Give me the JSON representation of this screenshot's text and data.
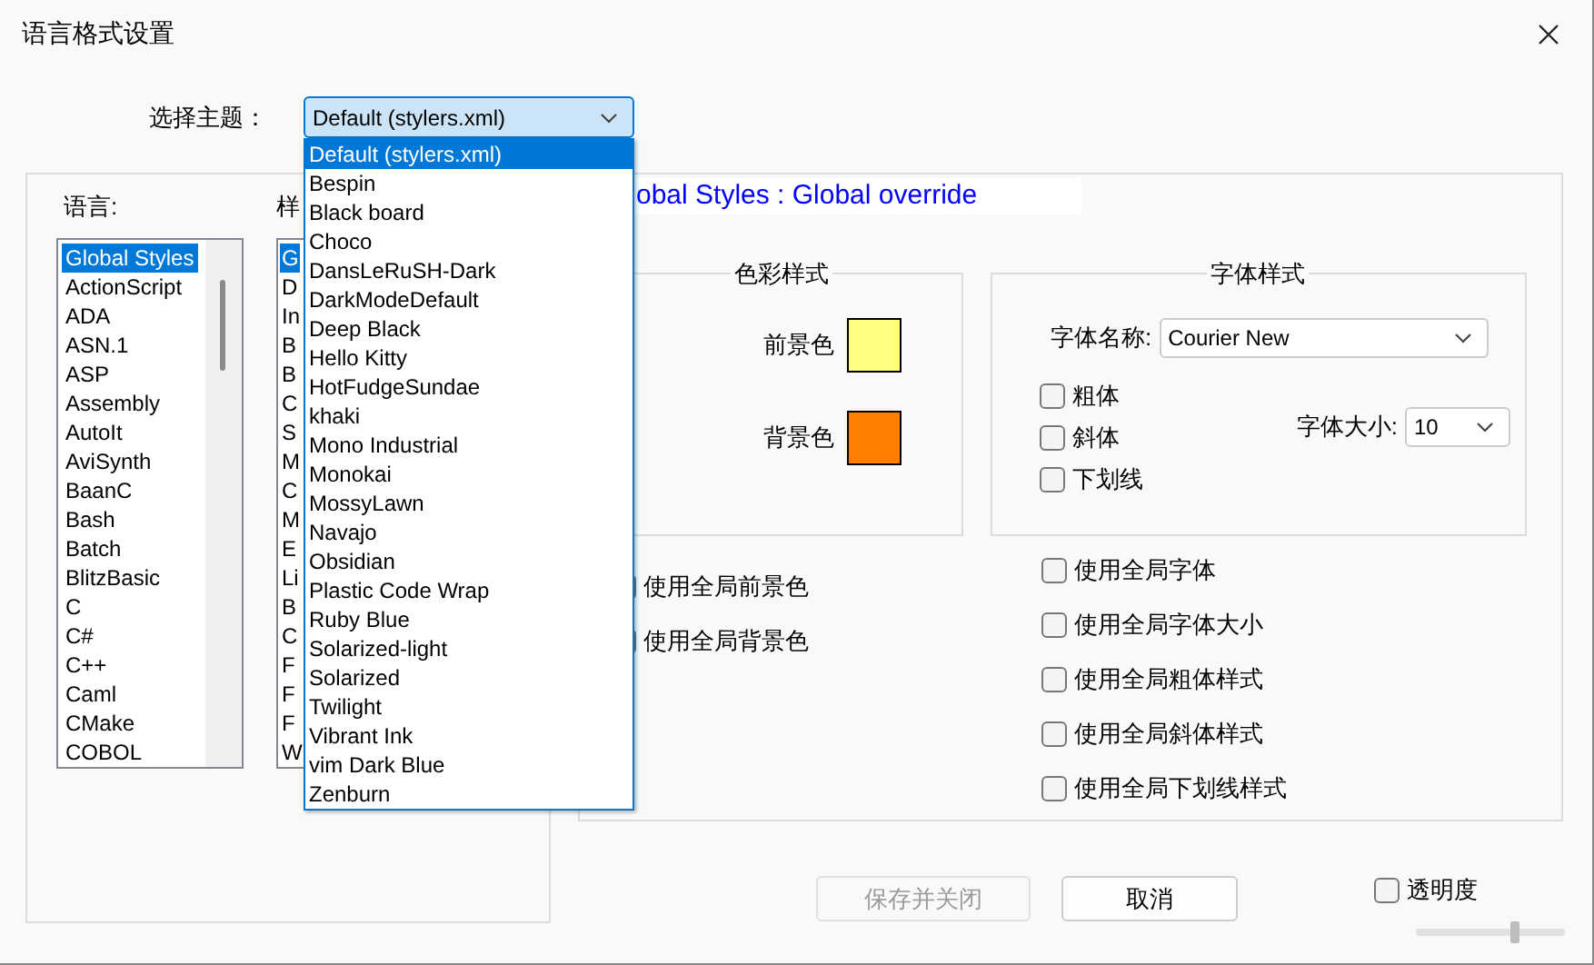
{
  "window": {
    "title": "语言格式设置"
  },
  "theme": {
    "label": "选择主题：",
    "value": "Default (stylers.xml)",
    "expanded": true,
    "options": [
      {
        "label": "Default (stylers.xml)",
        "selected": true
      },
      {
        "label": "Bespin",
        "selected": false
      },
      {
        "label": "Black board",
        "selected": false
      },
      {
        "label": "Choco",
        "selected": false
      },
      {
        "label": "DansLeRuSH-Dark",
        "selected": false
      },
      {
        "label": "DarkModeDefault",
        "selected": false
      },
      {
        "label": "Deep Black",
        "selected": false
      },
      {
        "label": "Hello Kitty",
        "selected": false
      },
      {
        "label": "HotFudgeSundae",
        "selected": false
      },
      {
        "label": "khaki",
        "selected": false
      },
      {
        "label": "Mono Industrial",
        "selected": false
      },
      {
        "label": "Monokai",
        "selected": false
      },
      {
        "label": "MossyLawn",
        "selected": false
      },
      {
        "label": "Navajo",
        "selected": false
      },
      {
        "label": "Obsidian",
        "selected": false
      },
      {
        "label": "Plastic Code Wrap",
        "selected": false
      },
      {
        "label": "Ruby Blue",
        "selected": false
      },
      {
        "label": "Solarized-light",
        "selected": false
      },
      {
        "label": "Solarized",
        "selected": false
      },
      {
        "label": "Twilight",
        "selected": false
      },
      {
        "label": "Vibrant Ink",
        "selected": false
      },
      {
        "label": "vim Dark Blue",
        "selected": false
      },
      {
        "label": "Zenburn",
        "selected": false
      }
    ]
  },
  "language": {
    "label": "语言:",
    "items": [
      {
        "label": "Global Styles",
        "selected": true
      },
      {
        "label": "ActionScript",
        "selected": false
      },
      {
        "label": "ADA",
        "selected": false
      },
      {
        "label": "ASN.1",
        "selected": false
      },
      {
        "label": "ASP",
        "selected": false
      },
      {
        "label": "Assembly",
        "selected": false
      },
      {
        "label": "AutoIt",
        "selected": false
      },
      {
        "label": "AviSynth",
        "selected": false
      },
      {
        "label": "BaanC",
        "selected": false
      },
      {
        "label": "Bash",
        "selected": false
      },
      {
        "label": "Batch",
        "selected": false
      },
      {
        "label": "BlitzBasic",
        "selected": false
      },
      {
        "label": "C",
        "selected": false
      },
      {
        "label": "C#",
        "selected": false
      },
      {
        "label": "C++",
        "selected": false
      },
      {
        "label": "Caml",
        "selected": false
      },
      {
        "label": "CMake",
        "selected": false
      },
      {
        "label": "COBOL",
        "selected": false
      }
    ]
  },
  "style": {
    "label": "样",
    "items": [
      {
        "label": "G",
        "selected": true
      },
      {
        "label": "D",
        "selected": false
      },
      {
        "label": "In",
        "selected": false
      },
      {
        "label": "B",
        "selected": false
      },
      {
        "label": "B",
        "selected": false
      },
      {
        "label": "C",
        "selected": false
      },
      {
        "label": "S",
        "selected": false
      },
      {
        "label": "M",
        "selected": false
      },
      {
        "label": "C",
        "selected": false
      },
      {
        "label": "M",
        "selected": false
      },
      {
        "label": "E",
        "selected": false
      },
      {
        "label": "Li",
        "selected": false
      },
      {
        "label": "B",
        "selected": false
      },
      {
        "label": "C",
        "selected": false
      },
      {
        "label": "F",
        "selected": false
      },
      {
        "label": "F",
        "selected": false
      },
      {
        "label": "F",
        "selected": false
      },
      {
        "label": "W",
        "selected": false
      }
    ]
  },
  "style_heading": "obal Styles : Global override",
  "color_style": {
    "title": "色彩样式",
    "swatches": [
      {
        "label": "前景色",
        "color": "#ffff80"
      },
      {
        "label": "背景色",
        "color": "#ff8000"
      }
    ]
  },
  "font_style": {
    "title": "字体样式",
    "name_label": "字体名称:",
    "name_value": "Courier New",
    "size_label": "字体大小:",
    "size_value": "10",
    "options": [
      {
        "label": "粗体",
        "checked": false
      },
      {
        "label": "斜体",
        "checked": false
      },
      {
        "label": "下划线",
        "checked": false
      }
    ]
  },
  "global_color_options": [
    {
      "label": "使用全局前景色",
      "checked": false
    },
    {
      "label": "使用全局背景色",
      "checked": false
    }
  ],
  "global_font_options": [
    {
      "label": "使用全局字体",
      "checked": false
    },
    {
      "label": "使用全局字体大小",
      "checked": false
    },
    {
      "label": "使用全局粗体样式",
      "checked": false
    },
    {
      "label": "使用全局斜体样式",
      "checked": false
    },
    {
      "label": "使用全局下划线样式",
      "checked": false
    }
  ],
  "buttons": [
    {
      "label": "保存并关闭",
      "disabled": true
    },
    {
      "label": "取消",
      "disabled": false
    }
  ],
  "transparency": {
    "label": "透明度",
    "checked": false,
    "level": 0.66
  }
}
